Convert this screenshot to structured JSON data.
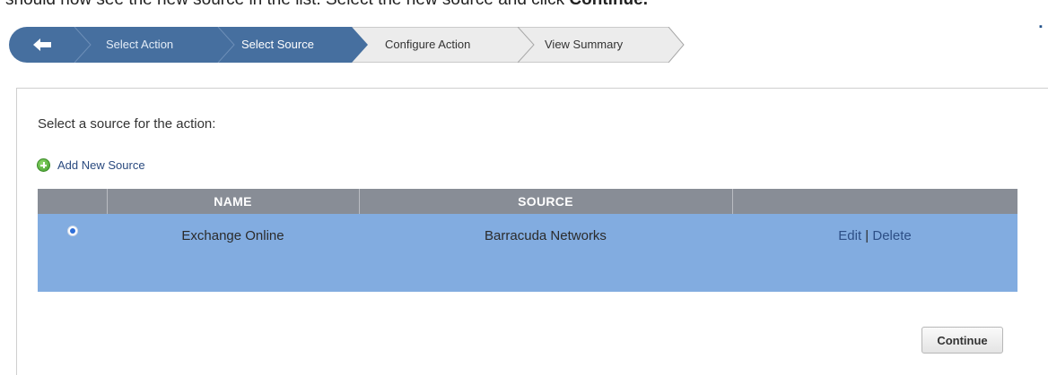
{
  "instruction": {
    "prefix": "should now see the new source in the list. Select the new source and click ",
    "bold": "Continue."
  },
  "wizard": {
    "steps": [
      {
        "label": "Select Action",
        "state": "done"
      },
      {
        "label": "Select Source",
        "state": "active"
      },
      {
        "label": "Configure Action",
        "state": "pending"
      },
      {
        "label": "View Summary",
        "state": "pending"
      }
    ],
    "back_icon": "arrow-left-icon"
  },
  "panel": {
    "prompt": "Select a source for the action:",
    "add_source_label": "Add New Source",
    "add_icon": "plus-circle-icon"
  },
  "table": {
    "columns": [
      "",
      "NAME",
      "SOURCE",
      ""
    ],
    "rows": [
      {
        "selected": true,
        "name": "Exchange Online",
        "source": "Barracuda Networks",
        "edit": "Edit",
        "separator": "|",
        "delete": "Delete"
      }
    ]
  },
  "continue_label": "Continue",
  "colors": {
    "wizard_done": "#466f9f",
    "wizard_active": "#466f9f",
    "wizard_pending": "#ececec",
    "table_header": "#888d96",
    "row_selected": "#82ace0",
    "link": "#2d4f86"
  }
}
